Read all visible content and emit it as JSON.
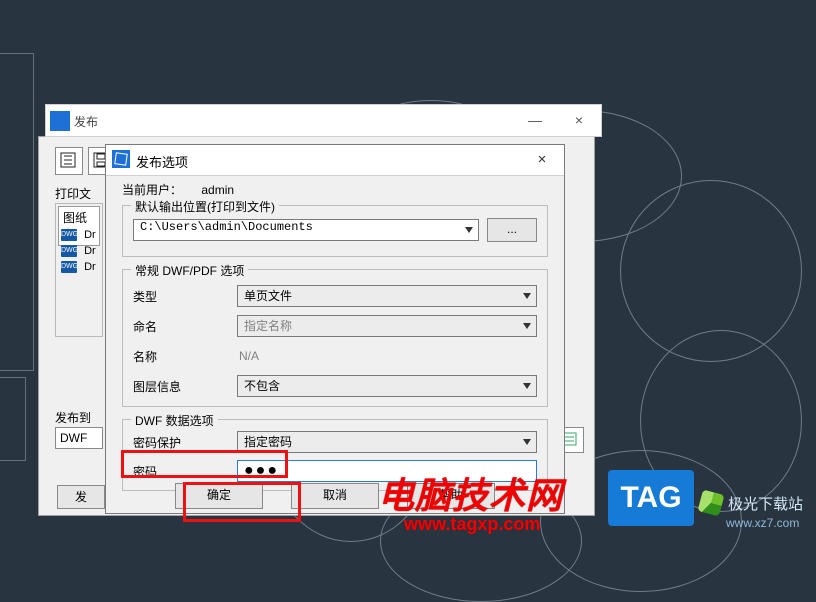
{
  "bg_parent": {
    "title_fragment": "发布",
    "window_buttons": {
      "min": "—",
      "close": "×"
    },
    "section_print": "打印文",
    "list_header": "图纸名",
    "file_items": [
      "Dr",
      "Dr",
      "Dr"
    ],
    "section_publish_to": "发布到",
    "publish_to_value": "DWF",
    "bottom_button_fragment": "发"
  },
  "dialog": {
    "title": "发布选项",
    "close": "×",
    "current_user_label": "当前用户：",
    "current_user_value": "admin",
    "output_group_legend": "默认输出位置(打印到文件)",
    "output_path": "C:\\Users\\admin\\Documents",
    "browse_label": "...",
    "dwf_group_legend": "常规 DWF/PDF 选项",
    "rows": {
      "type_label": "类型",
      "type_value": "单页文件",
      "naming_label": "命名",
      "naming_value": "指定名称",
      "name_label": "名称",
      "name_value": "N/A",
      "layer_label": "图层信息",
      "layer_value": "不包含"
    },
    "data_group_legend": "DWF 数据选项",
    "pw_protect_label": "密码保护",
    "pw_protect_value": "指定密码",
    "pw_label": "密码",
    "pw_value": "●●●",
    "buttons": {
      "ok": "确定",
      "cancel": "取消",
      "help": "帮助"
    }
  },
  "watermark": {
    "line1": "电脑技术网",
    "line2": "www.tagxp.com",
    "tag_badge": "TAG",
    "xz_name": "极光下载站",
    "xz_url": "www.xz7.com"
  }
}
